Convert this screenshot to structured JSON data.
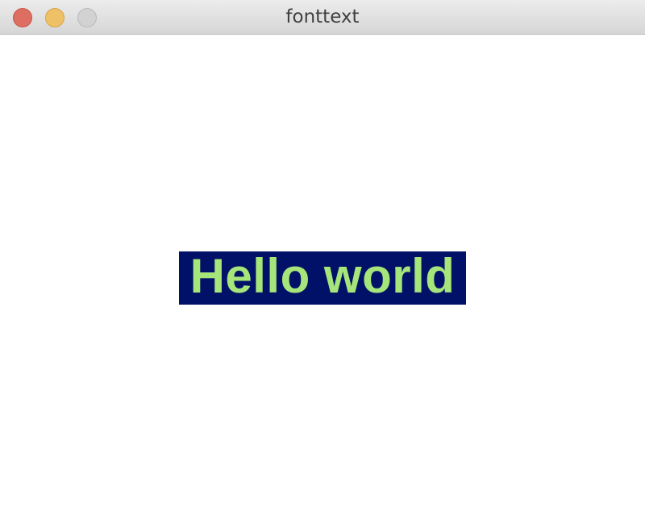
{
  "window": {
    "title": "fonttext"
  },
  "content": {
    "label_text": "Hello world",
    "label_background_color": "#011167",
    "label_text_color": "#a6e57a"
  },
  "controls": {
    "close_icon": "close-icon",
    "minimize_icon": "minimize-icon",
    "zoom_icon": "zoom-icon"
  }
}
